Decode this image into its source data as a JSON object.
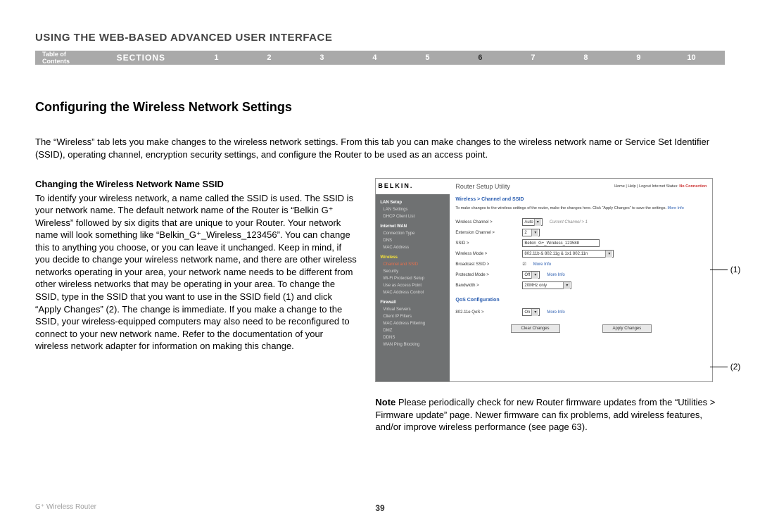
{
  "header": "USING THE WEB-BASED ADVANCED USER INTERFACE",
  "nav": {
    "toc": "Table of Contents",
    "sections_label": "SECTIONS",
    "items": [
      "1",
      "2",
      "3",
      "4",
      "5",
      "6",
      "7",
      "8",
      "9",
      "10"
    ],
    "active": "6"
  },
  "section_title": "Configuring the Wireless Network Settings",
  "intro": "The “Wireless” tab lets you make changes to the wireless network settings. From this tab you can make changes to the wireless network name or Service Set Identifier (SSID), operating channel, encryption security settings, and configure the Router to be used as an access point.",
  "left": {
    "subhead": "Changing the Wireless Network Name SSID",
    "body": "To identify your wireless network, a name called the SSID  is used. The SSID is your network name. The default network name of the Router is “Belkin G⁺ Wireless” followed by six digits that are unique to your Router. Your network name will look something like “Belkin_G⁺_Wireless_123456”. You can change this to anything you choose, or you can leave it unchanged. Keep in mind, if you decide to change your wireless network name, and there are other wireless networks operating in your area, your network name needs to be different from other wireless networks that may be operating in your area. To change the SSID, type in the SSID that you want to use in the SSID field (1) and click “Apply Changes” (2). The change is immediate. If you make a change to the SSID, your wireless-equipped computers may also need to be reconfigured to connect to your new network name. Refer to the documentation of your wireless network adapter for information on making this change."
  },
  "router": {
    "brand": "BELKIN.",
    "title": "Router Setup Utility",
    "topnav": "Home | Help | Logout   Internet Status:",
    "status": "No Connection",
    "crumb": "Wireless > Channel and SSID",
    "hint_a": "To make changes to the wireless settings of the router, make the changes here. Click “Apply Changes” to save the settings.",
    "hint_more": "More Info",
    "sidebar": {
      "lan_setup": "LAN Setup",
      "lan_settings": "LAN Settings",
      "dhcp": "DHCP Client List",
      "internet_wan": "Internet WAN",
      "conn_type": "Connection Type",
      "dns": "DNS",
      "mac": "MAC Address",
      "wireless": "Wireless",
      "chan_ssid": "Channel and SSID",
      "security": "Security",
      "wps": "Wi-Fi Protected Setup",
      "ap": "Use as Access Point",
      "maccontrol": "MAC Address Control",
      "firewall": "Firewall",
      "vs": "Virtual Servers",
      "cif": "Client IP Filters",
      "maf": "MAC Address Filtering",
      "dmz": "DMZ",
      "ddns": "DDNS",
      "wanping": "WAN Ping Blocking"
    },
    "rows": {
      "wireless_channel_lbl": "Wireless Channel >",
      "wireless_channel_val": "Auto",
      "wireless_channel_note": "Current Channel > 1",
      "ext_channel_lbl": "Extension Channel >",
      "ext_channel_val": "2",
      "ssid_lbl": "SSID >",
      "ssid_val": "Belkin_G+_Wireless_123588",
      "mode_lbl": "Wireless Mode >",
      "mode_val": "802.11b & 802.11g & 1x1 802.11n",
      "broadcast_lbl": "Broadcast SSID >",
      "broadcast_val": "☑",
      "protected_lbl": "Protected Mode >",
      "protected_val": "Off",
      "bandwidth_lbl": "Bandwidth >",
      "bandwidth_val": "20MHz only",
      "more_info": "More Info"
    },
    "qos_head": "QoS Configuration",
    "qos_lbl": "802.11e QoS >",
    "qos_val": "On",
    "btn_clear": "Clear Changes",
    "btn_apply": "Apply Changes"
  },
  "callouts": {
    "c1": "(1)",
    "c2": "(2)"
  },
  "note_label": "Note",
  "note_body": " Please periodically check for new Router firmware updates from the “Utilities > Firmware update” page. Newer firmware can fix problems, add wireless features, and/or improve wireless performance (see page 63).",
  "footer": {
    "product": "G⁺ Wireless Router",
    "page": "39"
  }
}
